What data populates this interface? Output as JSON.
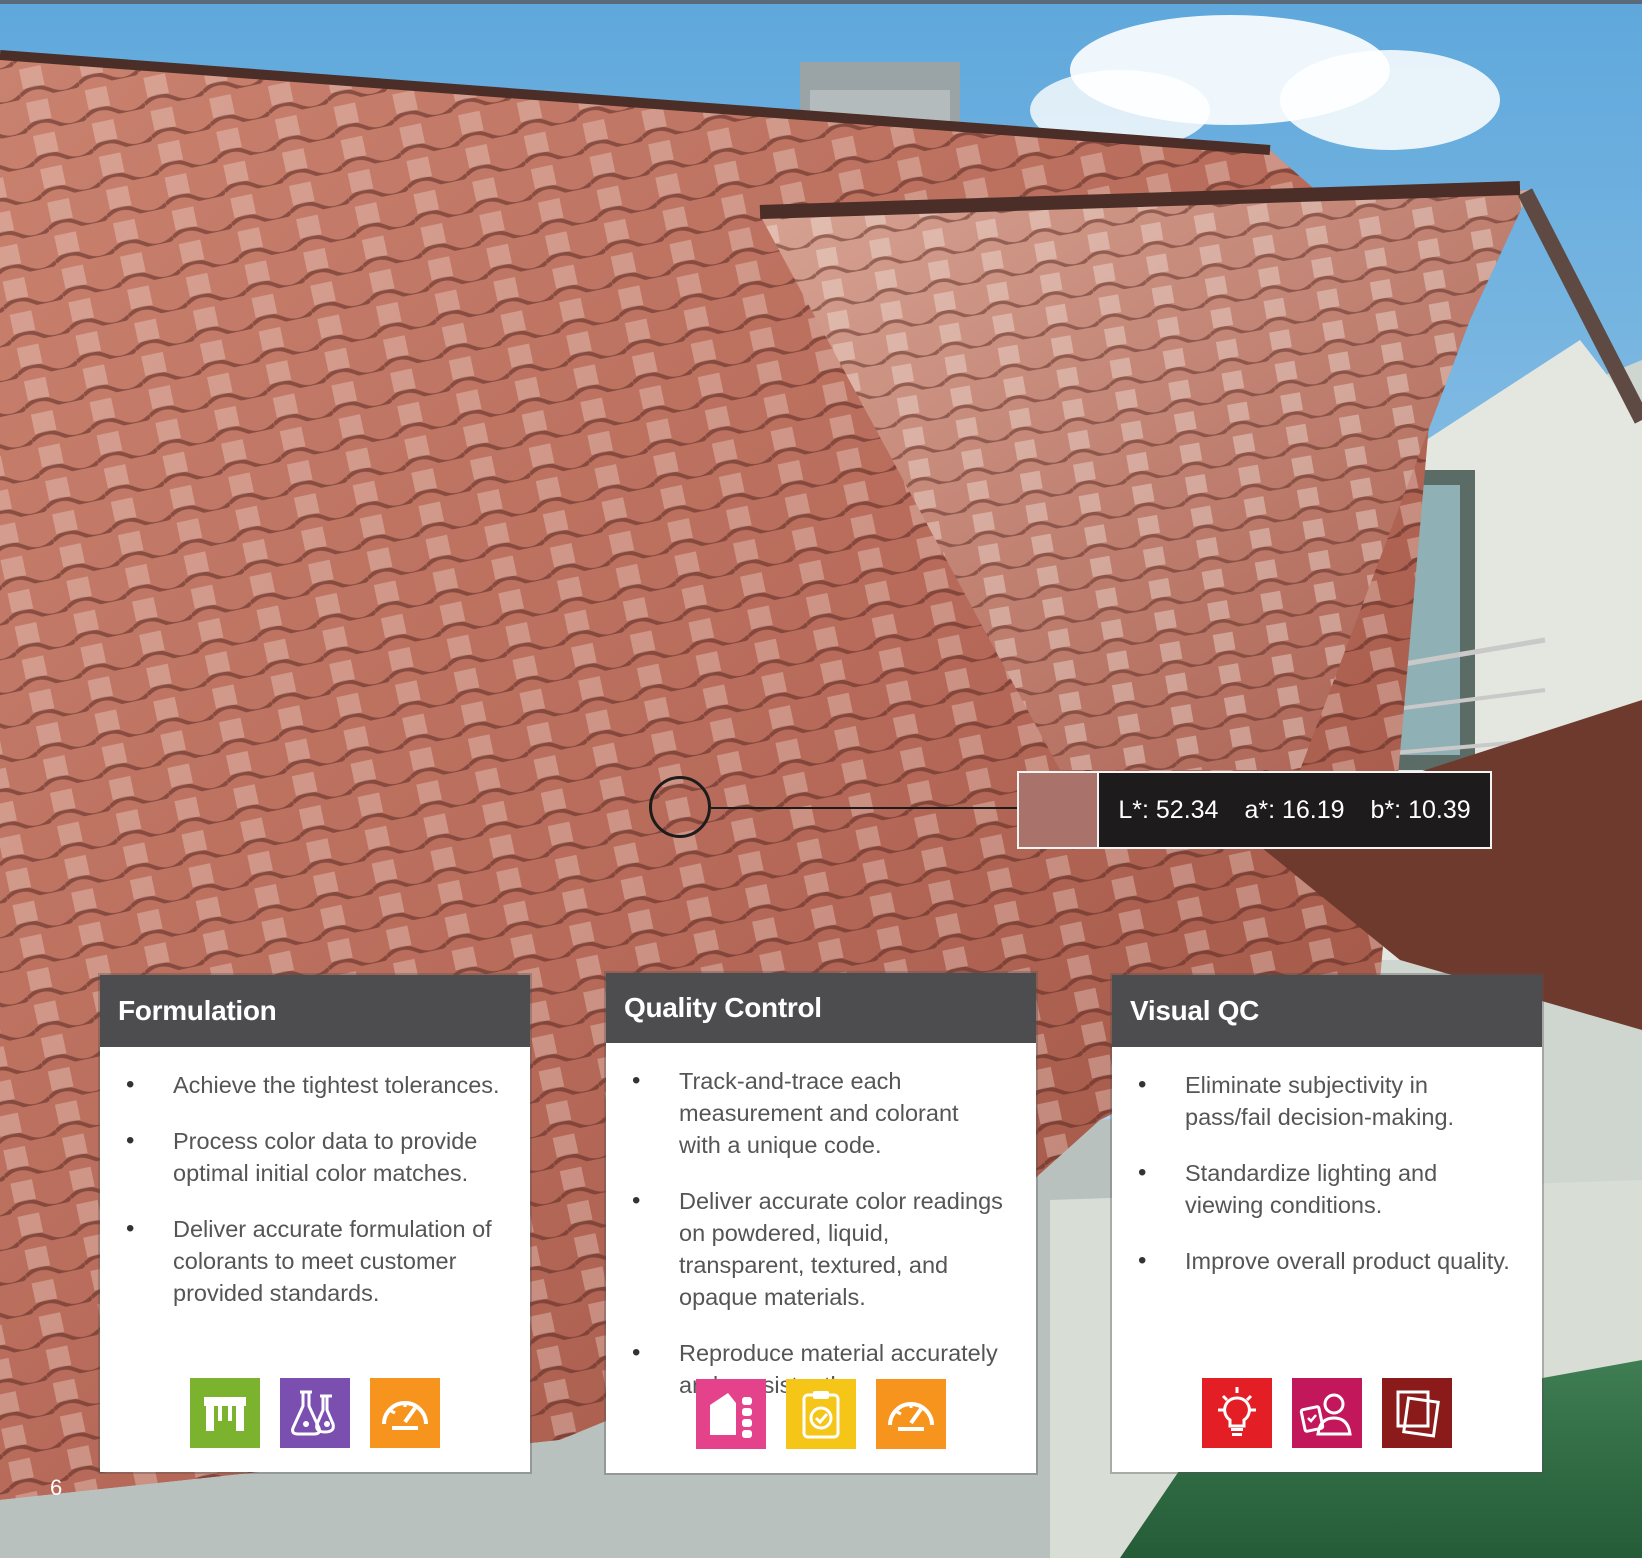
{
  "readout": {
    "swatch_color": "#a9726a",
    "L": "L*: 52.34",
    "a": "a*: 16.19",
    "b": "b*: 10.39"
  },
  "cards": [
    {
      "title": "Formulation",
      "bullets": [
        "Achieve the tightest tolerances.",
        "Process color data to provide optimal initial color matches.",
        "Deliver accurate formulation of colorants to meet customer provided standards."
      ],
      "icons": [
        {
          "name": "table-icon",
          "color": "#7bb32e"
        },
        {
          "name": "flask-icon",
          "color": "#7a4fb0"
        },
        {
          "name": "gauge-icon",
          "color": "#f7941d"
        }
      ]
    },
    {
      "title": "Quality Control",
      "bullets": [
        "Track-and-trace each measurement and colorant with a unique code.",
        "Deliver accurate color readings on powdered, liquid, transparent, textured, and opaque materials.",
        "Reproduce material accurately and consistently."
      ],
      "icons": [
        {
          "name": "spectro-icon",
          "color": "#e4428a"
        },
        {
          "name": "clipboard-check-icon",
          "color": "#f5c518"
        },
        {
          "name": "gauge-icon",
          "color": "#f7941d"
        }
      ]
    },
    {
      "title": "Visual QC",
      "bullets": [
        "Eliminate subjectivity in pass/fail decision-making.",
        "Standardize lighting and viewing conditions.",
        "Improve overall product quality."
      ],
      "icons": [
        {
          "name": "lightbulb-icon",
          "color": "#e31e24"
        },
        {
          "name": "user-checklist-icon",
          "color": "#c2185b"
        },
        {
          "name": "swatches-icon",
          "color": "#8b1a1a"
        }
      ]
    }
  ],
  "page_number": "6"
}
